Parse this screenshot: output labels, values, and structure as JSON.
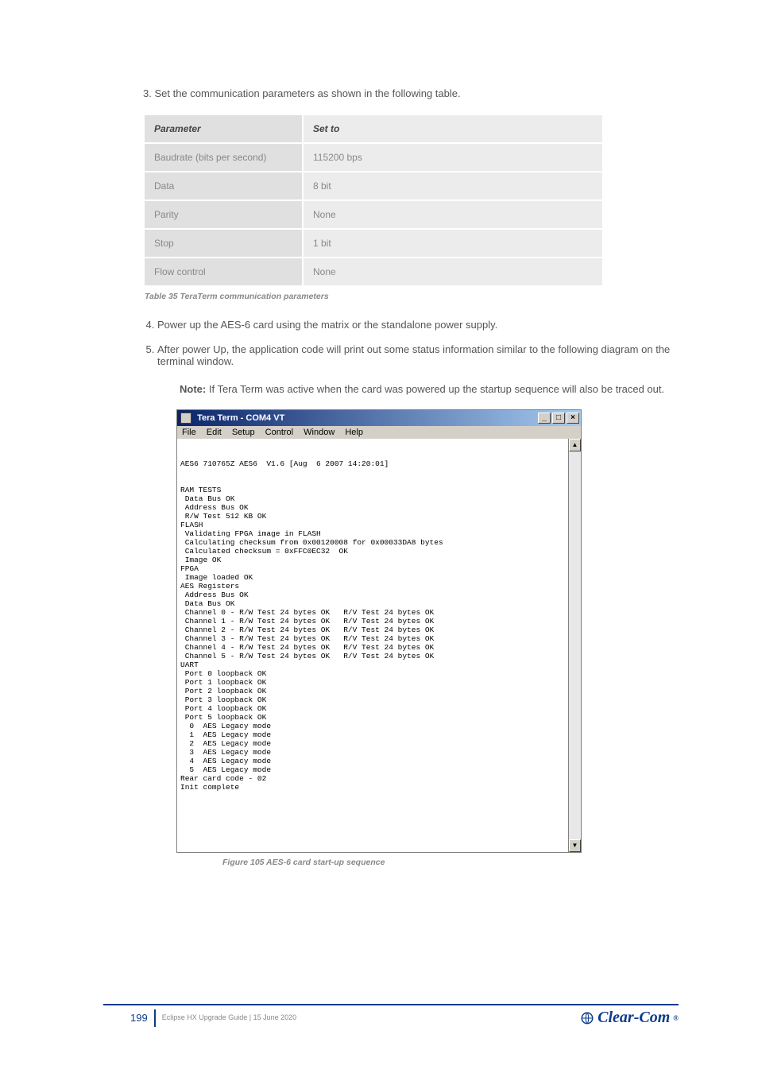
{
  "intro": "3. Set the communication parameters as shown in the following table.",
  "table": {
    "header": [
      "Parameter",
      "Set to"
    ],
    "rows": [
      [
        "Baudrate (bits per second)",
        "115200 bps"
      ],
      [
        "Data",
        "8 bit"
      ],
      [
        "Parity",
        "None"
      ],
      [
        "Stop",
        "1 bit"
      ],
      [
        "Flow control",
        "None"
      ]
    ],
    "caption": "Table 35 TeraTerm communication parameters"
  },
  "steps": [
    "Power up the AES-6 card using the matrix or the standalone power supply.",
    "After power Up, the application code will print out some status information similar to the following diagram on the terminal window."
  ],
  "note_label": "Note: ",
  "note_body": "If Tera Term was active when the card was powered up the startup sequence will also be traced out.",
  "term": {
    "title": "Tera Term - COM4 VT",
    "menus": [
      "File",
      "Edit",
      "Setup",
      "Control",
      "Window",
      "Help"
    ],
    "btn_min": "_",
    "btn_max": "□",
    "btn_close": "×",
    "sb_up": "▲",
    "sb_down": "▼",
    "content": "\n\nAES6 710765Z AES6  V1.6 [Aug  6 2007 14:20:01]\n\n\nRAM TESTS\n Data Bus OK\n Address Bus OK\n R/W Test 512 KB OK\nFLASH\n Validating FPGA image in FLASH\n Calculating checksum from 0x00120008 for 0x00033DA8 bytes\n Calculated checksum = 0xFFC0EC32  OK\n Image OK\nFPGA\n Image loaded OK\nAES Registers\n Address Bus OK\n Data Bus OK\n Channel 0 - R/W Test 24 bytes OK   R/V Test 24 bytes OK\n Channel 1 - R/W Test 24 bytes OK   R/V Test 24 bytes OK\n Channel 2 - R/W Test 24 bytes OK   R/V Test 24 bytes OK\n Channel 3 - R/W Test 24 bytes OK   R/V Test 24 bytes OK\n Channel 4 - R/W Test 24 bytes OK   R/V Test 24 bytes OK\n Channel 5 - R/W Test 24 bytes OK   R/V Test 24 bytes OK\nUART\n Port 0 loopback OK\n Port 1 loopback OK\n Port 2 loopback OK\n Port 3 loopback OK\n Port 4 loopback OK\n Port 5 loopback OK\n  0  AES Legacy mode\n  1  AES Legacy mode\n  2  AES Legacy mode\n  3  AES Legacy mode\n  4  AES Legacy mode\n  5  AES Legacy mode\nRear card code - 02\nInit complete\n\n\n"
  },
  "fig_caption": "Figure 105 AES-6 card start-up sequence",
  "footer": {
    "page": "199",
    "line1": "Eclipse HX Upgrade Guide | 15 June 2020",
    "line2": "",
    "brand": "Clear-Com"
  }
}
